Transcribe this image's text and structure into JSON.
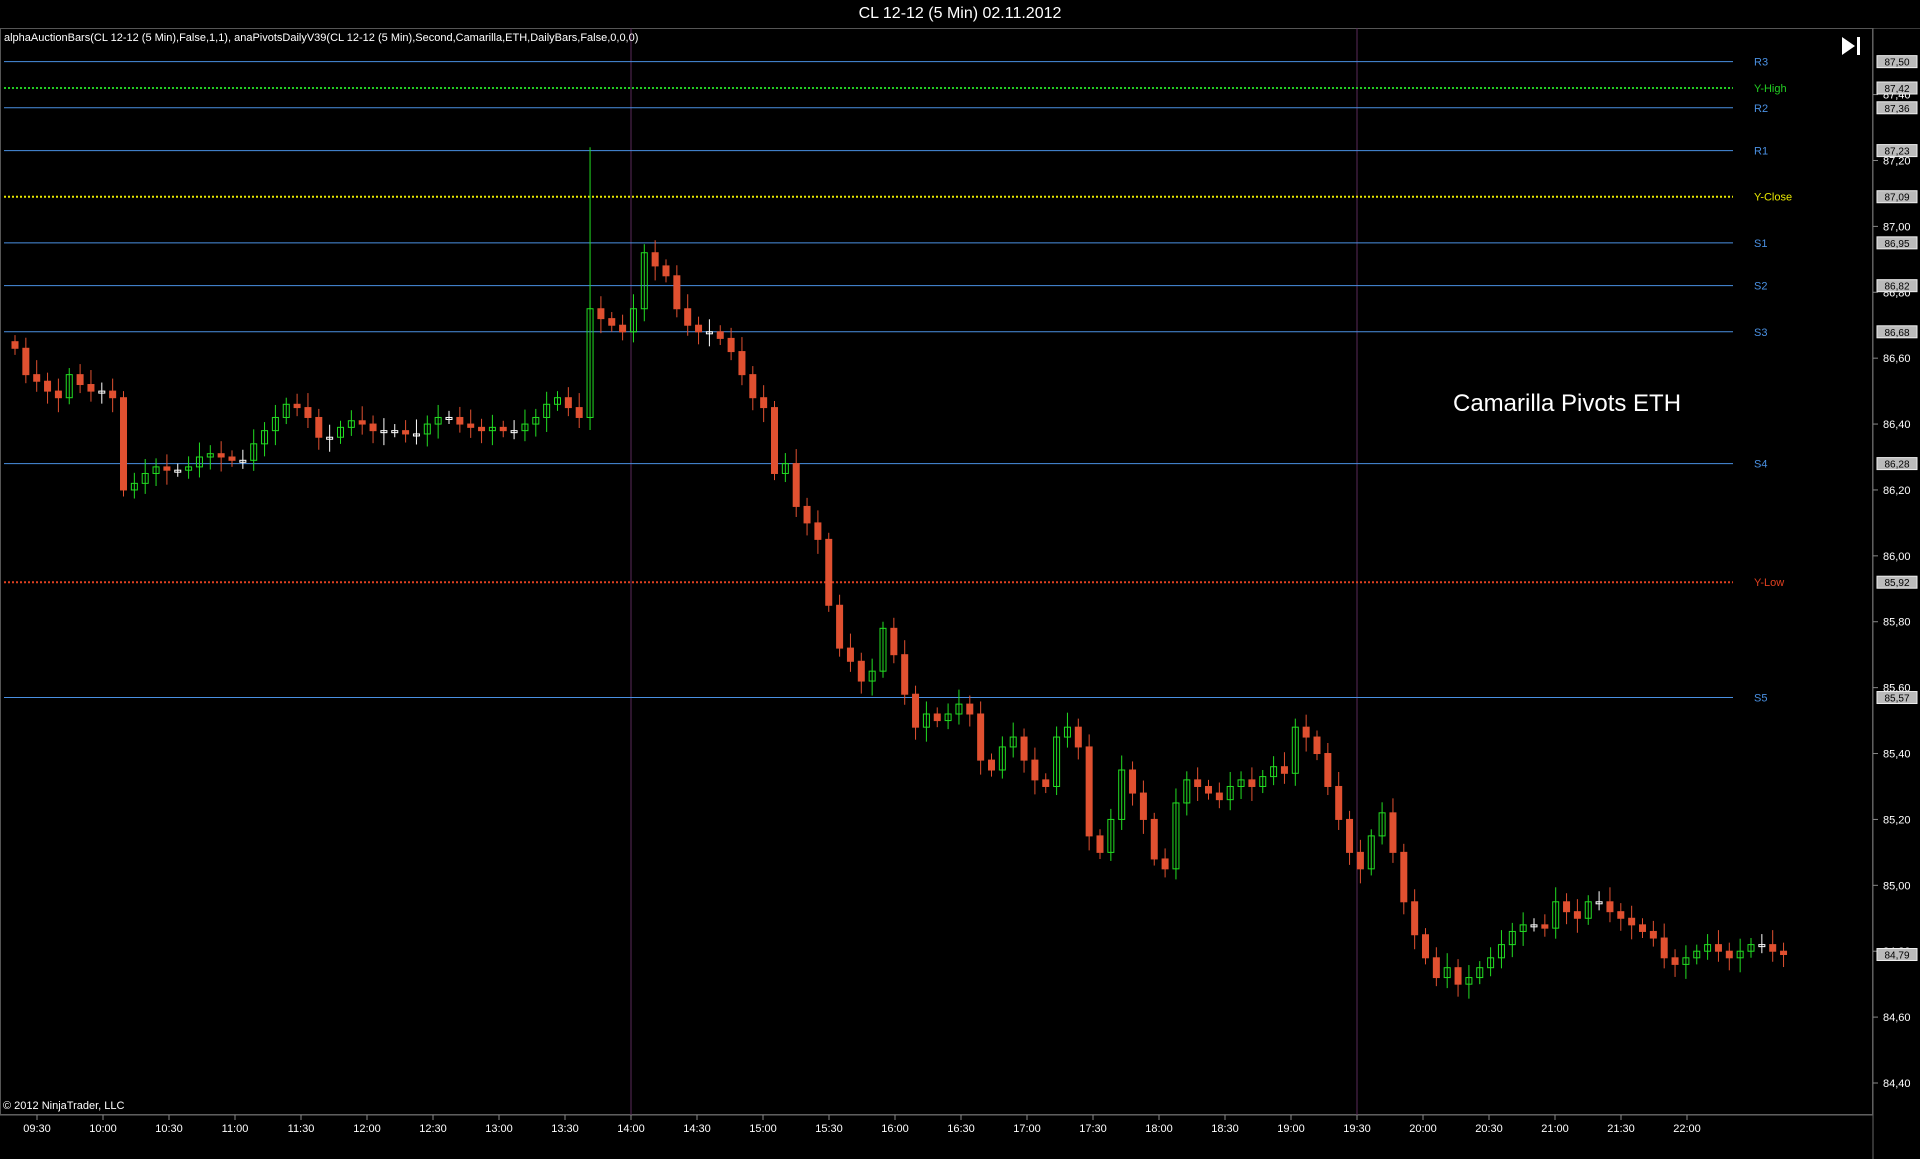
{
  "window": {
    "title": "CL 12-12 (5 Min)  02.11.2012"
  },
  "indicators": "alphaAuctionBars(CL 12-12 (5 Min),False,1,1), anaPivotsDailyV39(CL 12-12 (5 Min),Second,Camarilla,ETH,DailyBars,False,0,0,0)",
  "watermark": "Camarilla Pivots ETH",
  "copyright": "© 2012 NinjaTrader, LLC",
  "colors": {
    "background": "#000000",
    "pivot": "#4a90e2",
    "y_high": "#22cc22",
    "y_close": "#e6e600",
    "y_low": "#e04020",
    "up": "#22dd22",
    "down": "#e05030",
    "flat": "#ffffff",
    "highlight_up": "#ffcc33"
  },
  "icons": {
    "goto_end": "skip-to-end-icon"
  },
  "chart_data": {
    "type": "candlestick",
    "ylim": [
      84.33,
      87.65
    ],
    "y_ticks": [
      "87,40",
      "87,20",
      "87,00",
      "86,80",
      "86,60",
      "86,40",
      "86,20",
      "86,00",
      "85,80",
      "85,60",
      "85,40",
      "85,20",
      "85,00",
      "84,80",
      "84,60",
      "84,40"
    ],
    "y_tick_values": [
      87.4,
      87.2,
      87.0,
      86.8,
      86.6,
      86.4,
      86.2,
      86.0,
      85.8,
      85.6,
      85.4,
      85.2,
      85.0,
      84.8,
      84.6,
      84.4
    ],
    "x_ticks": [
      "09:30",
      "10:00",
      "10:30",
      "11:00",
      "11:30",
      "12:00",
      "12:30",
      "13:00",
      "13:30",
      "14:00",
      "14:30",
      "15:00",
      "15:30",
      "16:00",
      "16:30",
      "17:00",
      "17:30",
      "18:00",
      "18:30",
      "19:00",
      "19:30",
      "20:00",
      "20:30",
      "21:00",
      "21:30",
      "22:00"
    ],
    "levels": [
      {
        "name": "R3",
        "value": 87.5,
        "label": "87,50",
        "style": "pivot"
      },
      {
        "name": "Y-High",
        "value": 87.42,
        "label": "87,42",
        "style": "y_high"
      },
      {
        "name": "R2",
        "value": 87.36,
        "label": "87,36",
        "style": "pivot"
      },
      {
        "name": "R1",
        "value": 87.23,
        "label": "87,23",
        "style": "pivot"
      },
      {
        "name": "Y-Close",
        "value": 87.09,
        "label": "87,09",
        "style": "y_close"
      },
      {
        "name": "S1",
        "value": 86.95,
        "label": "86,95",
        "style": "pivot"
      },
      {
        "name": "S2",
        "value": 86.82,
        "label": "86,82",
        "style": "pivot"
      },
      {
        "name": "S3",
        "value": 86.68,
        "label": "86,68",
        "style": "pivot"
      },
      {
        "name": "S4",
        "value": 86.28,
        "label": "86,28",
        "style": "pivot"
      },
      {
        "name": "Y-Low",
        "value": 85.92,
        "label": "85,92",
        "style": "y_low"
      },
      {
        "name": "S5",
        "value": 85.57,
        "label": "85,57",
        "style": "pivot"
      }
    ],
    "last_price": {
      "value": 84.79,
      "label": "84,79"
    },
    "session_breaks": [
      "14:00",
      "19:30"
    ],
    "close_path": [
      86.63,
      86.55,
      86.53,
      86.5,
      86.48,
      86.55,
      86.52,
      86.5,
      86.5,
      86.48,
      86.2,
      86.22,
      86.25,
      86.27,
      86.26,
      86.26,
      86.27,
      86.3,
      86.31,
      86.3,
      86.29,
      86.29,
      86.34,
      86.38,
      86.42,
      86.46,
      86.45,
      86.42,
      86.36,
      86.36,
      86.39,
      86.41,
      86.4,
      86.38,
      86.38,
      86.38,
      86.37,
      86.37,
      86.4,
      86.42,
      86.42,
      86.4,
      86.39,
      86.38,
      86.39,
      86.38,
      86.38,
      86.4,
      86.42,
      86.46,
      86.48,
      86.45,
      86.42,
      86.75,
      86.72,
      86.7,
      86.68,
      86.75,
      86.92,
      86.88,
      86.85,
      86.75,
      86.7,
      86.68,
      86.68,
      86.66,
      86.62,
      86.55,
      86.48,
      86.45,
      86.25,
      86.28,
      86.15,
      86.1,
      86.05,
      85.85,
      85.72,
      85.68,
      85.62,
      85.65,
      85.78,
      85.7,
      85.58,
      85.48,
      85.52,
      85.5,
      85.52,
      85.55,
      85.52,
      85.38,
      85.35,
      85.42,
      85.45,
      85.38,
      85.32,
      85.3,
      85.45,
      85.48,
      85.42,
      85.15,
      85.1,
      85.2,
      85.35,
      85.28,
      85.2,
      85.08,
      85.05,
      85.25,
      85.32,
      85.3,
      85.28,
      85.26,
      85.3,
      85.32,
      85.3,
      85.33,
      85.36,
      85.34,
      85.48,
      85.45,
      85.4,
      85.3,
      85.2,
      85.1,
      85.05,
      85.15,
      85.22,
      85.1,
      84.95,
      84.85,
      84.78,
      84.72,
      84.75,
      84.7,
      84.72,
      84.75,
      84.78,
      84.82,
      84.86,
      84.88,
      84.88,
      84.87,
      84.95,
      84.92,
      84.9,
      84.95,
      84.95,
      84.92,
      84.9,
      84.88,
      84.86,
      84.84,
      84.78,
      84.76,
      84.78,
      84.8,
      84.82,
      84.8,
      84.78,
      84.8,
      84.82,
      84.82,
      84.8,
      84.79
    ]
  }
}
